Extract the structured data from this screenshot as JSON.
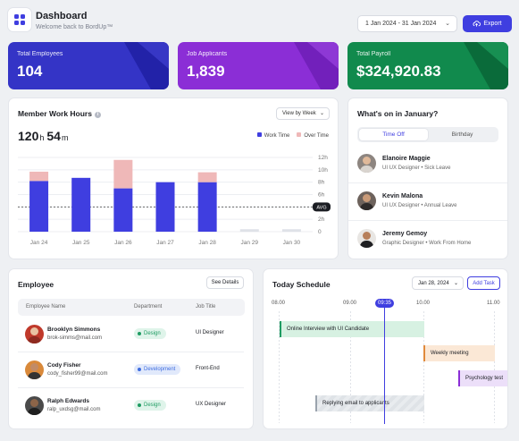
{
  "header": {
    "title": "Dashboard",
    "subtitle": "Welcome back to BordUp™",
    "date_range": "1 Jan 2024 - 31 Jan 2024",
    "export_label": "Export"
  },
  "stats": [
    {
      "label": "Total Employees",
      "value": "104",
      "color": "#3434c6"
    },
    {
      "label": "Job Applicants",
      "value": "1,839",
      "color": "#8b2ed6"
    },
    {
      "label": "Total Payroll",
      "value": "$324,920.83",
      "color": "#118a4d"
    }
  ],
  "work_hours": {
    "title": "Member Work Hours",
    "period_select": "View by Week",
    "total_hours": "120",
    "total_hours_unit": "h",
    "total_minutes": "54",
    "total_minutes_unit": "m",
    "avg_label": "AVG"
  },
  "chart_data": {
    "type": "bar",
    "categories": [
      "Jan 24",
      "Jan 25",
      "Jan 26",
      "Jan 27",
      "Jan 28",
      "Jan 29",
      "Jan 30"
    ],
    "series": [
      {
        "name": "Work Time",
        "values": [
          8.2,
          8.7,
          7.0,
          8.0,
          8.0,
          0.4,
          0.4
        ],
        "color": "#3f3ee0"
      },
      {
        "name": "Over Time",
        "values": [
          1.5,
          0,
          4.6,
          0,
          1.6,
          0,
          0
        ],
        "color": "#efb8b8"
      }
    ],
    "yticks": [
      "12h",
      "10h",
      "8h",
      "6h",
      "4h",
      "2h",
      "0"
    ],
    "ylim": [
      0,
      12
    ],
    "avg": 4
  },
  "january": {
    "title": "What's on in January?",
    "tabs": [
      "Time Off",
      "Birthday"
    ],
    "active_tab": 0,
    "people": [
      {
        "name": "Elanoire Maggie",
        "role": "UI UX Designer",
        "status": "Sick Leave"
      },
      {
        "name": "Kevin Malona",
        "role": "UI UX Designer",
        "status": "Annual Leave"
      },
      {
        "name": "Jeremy Gemoy",
        "role": "Graphic Designer",
        "status": "Work From Home"
      }
    ]
  },
  "employee": {
    "title": "Employee",
    "details_label": "See Details",
    "columns": [
      "Employee Name",
      "Department",
      "Job Title"
    ],
    "rows": [
      {
        "name": "Brooklyn Simmons",
        "email": "brok-simms@mail.com",
        "department": "Design",
        "dept_color": "#1e9b62",
        "dept_bg": "#dff4ea",
        "job": "UI Designer"
      },
      {
        "name": "Cody Fisher",
        "email": "cody_fisher99@mail.com",
        "department": "Development",
        "dept_color": "#3f6ee0",
        "dept_bg": "#e1e9fb",
        "job": "Front-End"
      },
      {
        "name": "Ralph Edwards",
        "email": "ralp_uxdsg@mail.com",
        "department": "Design",
        "dept_color": "#1e9b62",
        "dept_bg": "#dff4ea",
        "job": "UX Designer"
      }
    ]
  },
  "schedule": {
    "title": "Today Schedule",
    "date": "Jan 28, 2024",
    "add_label": "Add Task",
    "times": [
      "08.00",
      "09.00",
      "10.00",
      "11.00"
    ],
    "now": "09:35",
    "events": [
      {
        "label": "Online Interview with UI Candidate",
        "color": "#1e9b62",
        "bg": "#d7f1e2"
      },
      {
        "label": "Weekly meeting",
        "color": "#e08a3c",
        "bg": "#fbe8d6"
      },
      {
        "label": "Psychology test",
        "color": "#8b2ed6",
        "bg": "#ecdff9"
      },
      {
        "label": "Replying email to applicants",
        "color": "#9aa3ad",
        "bg": "#e9ecef"
      }
    ]
  }
}
